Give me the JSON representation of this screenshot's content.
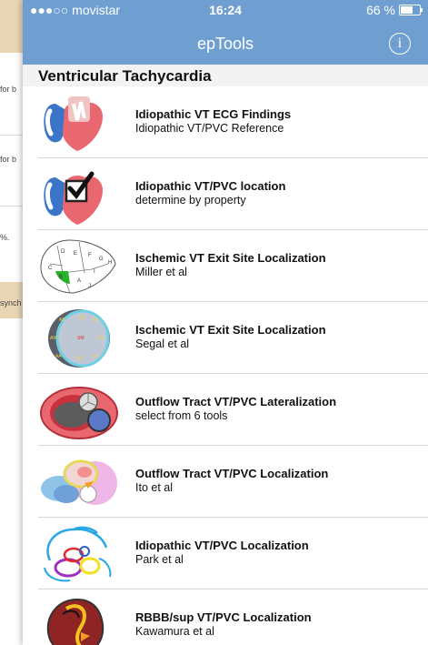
{
  "background_app": {
    "snippets": [
      "for b",
      "for b",
      "%.",
      "synch"
    ]
  },
  "status_bar": {
    "carrier": "●●●○○ movistar",
    "time": "16:24",
    "battery": "66 %",
    "battery_level_percent": 66
  },
  "nav": {
    "title": "epTools",
    "info_icon": "info-icon"
  },
  "section_header": "Ventricular Tachycardia",
  "items": [
    {
      "title": "Idiopathic VT ECG Findings",
      "subtitle": "Idiopathic VT/PVC Reference",
      "icon": "heart-ecg-icon"
    },
    {
      "title": "Idiopathic VT/PVC location",
      "subtitle": "determine by property",
      "icon": "heart-check-icon"
    },
    {
      "title": "Ischemic VT Exit Site Localization",
      "subtitle": "Miller et al",
      "icon": "miller-map-icon",
      "icon_labels": [
        "D",
        "E",
        "F",
        "G",
        "H",
        "C",
        "I",
        "B",
        "A",
        "J"
      ]
    },
    {
      "title": "Ischemic VT Exit Site Localization",
      "subtitle": "Segal et al",
      "icon": "segal-map-icon",
      "icon_labels": [
        "AB",
        "SB",
        "IB",
        "AM",
        "SM",
        "PM",
        "AA",
        "SA",
        "IA"
      ]
    },
    {
      "title": "Outflow Tract VT/PVC Lateralization",
      "subtitle": "select from 6 tools",
      "icon": "outflow-lateral-icon"
    },
    {
      "title": "Outflow Tract VT/PVC Localization",
      "subtitle": "Ito et al",
      "icon": "outflow-local-icon"
    },
    {
      "title": "Idiopathic VT/PVC Localization",
      "subtitle": "Park et al",
      "icon": "park-map-icon"
    },
    {
      "title": "RBBB/sup VT/PVC Localization",
      "subtitle": "Kawamura et al",
      "icon": "rbbb-heart-icon"
    }
  ]
}
